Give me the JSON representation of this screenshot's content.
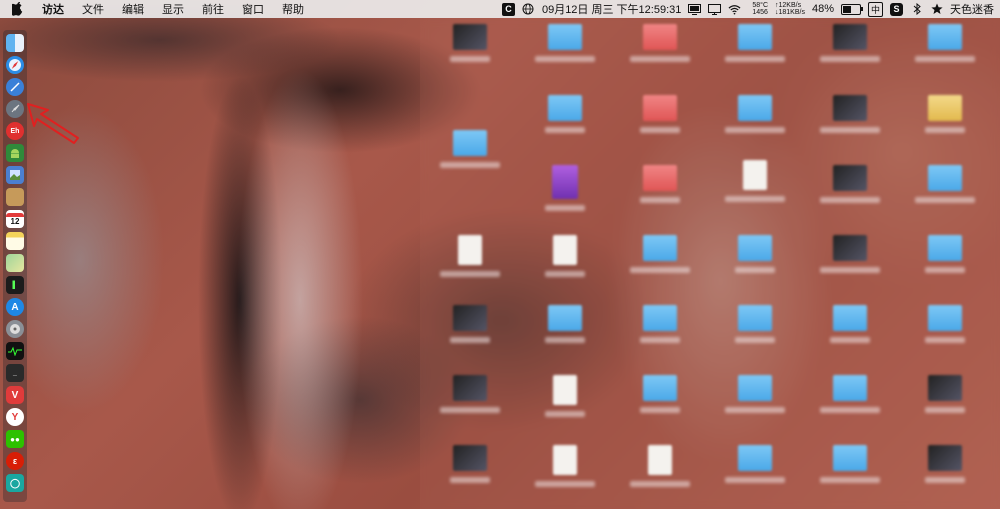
{
  "menubar": {
    "app_name": "访达",
    "menus": [
      "文件",
      "编辑",
      "显示",
      "前往",
      "窗口",
      "帮助"
    ],
    "datetime": "09月12日 周三 下午12:59:31",
    "sys_temp": "58°C",
    "sys_fan": "1456",
    "net_up": "↑12KB/s",
    "net_down": "↓181KB/s",
    "battery_percent": "48%",
    "input_method": "中",
    "user_name": "天色迷香"
  },
  "battery_level": 0.48,
  "dock": {
    "icons": [
      "finder-icon",
      "safari-icon",
      "appstore-compass-icon",
      "launchpad-rocket-icon",
      "weibo-icon",
      "android-icon",
      "preview-icon",
      "notes-book-icon",
      "calendar-icon",
      "notes-icon",
      "maps-icon",
      "terminal-icon",
      "app-store-icon",
      "disk-utility-icon",
      "activity-monitor-icon",
      "console-icon",
      "vivaldi-icon",
      "yandex-icon",
      "wechat-icon",
      "netease-music-icon",
      "wechat-work-icon"
    ],
    "calendar_day": "12"
  }
}
